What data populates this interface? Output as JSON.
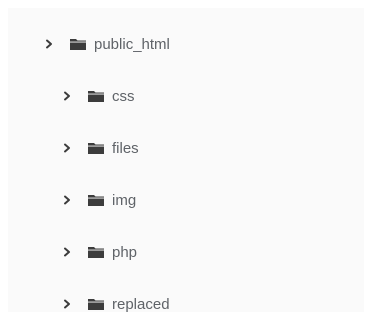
{
  "tree": {
    "root": {
      "label": "public_html",
      "icon": "folder-icon",
      "expanded": false
    },
    "children": [
      {
        "label": "css",
        "icon": "folder-icon",
        "expanded": false
      },
      {
        "label": "files",
        "icon": "folder-icon",
        "expanded": false
      },
      {
        "label": "img",
        "icon": "folder-icon",
        "expanded": false
      },
      {
        "label": "php",
        "icon": "folder-icon",
        "expanded": false
      },
      {
        "label": "replaced",
        "icon": "folder-icon",
        "expanded": false
      }
    ],
    "colors": {
      "icon": "#3c3c3c",
      "text": "#5f6368",
      "background": "#fafafa"
    }
  }
}
